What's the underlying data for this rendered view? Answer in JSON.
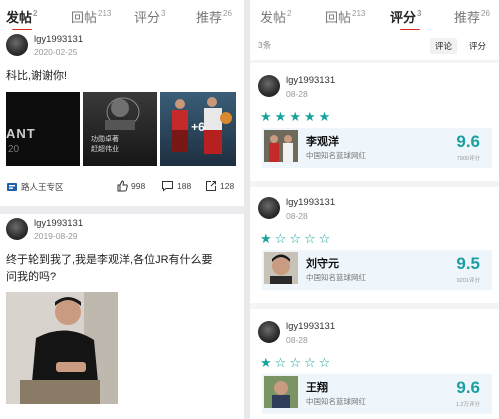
{
  "left": {
    "tabs": [
      {
        "label": "发帖",
        "count": "2",
        "active": true
      },
      {
        "label": "回帖",
        "count": "213",
        "active": false
      },
      {
        "label": "评分",
        "count": "3",
        "active": false
      },
      {
        "label": "推荐",
        "count": "26",
        "active": false
      }
    ],
    "posts": [
      {
        "username": "lgy1993131",
        "date": "2020-02-25",
        "text": "科比,谢谢你!",
        "image_overlay": "+6",
        "image_text_1": "ANT",
        "image_text_2": "20",
        "image_text_3": "功勋卓著",
        "image_text_4": "赶超伟业",
        "community": "路人王专区",
        "likes": "998",
        "comments": "188",
        "shares": "128"
      },
      {
        "username": "lgy1993131",
        "date": "2019-08-29",
        "text_line1": "终于轮到我了,我是李观洋,各位JR有什么要",
        "text_line2": "问我的吗?"
      }
    ]
  },
  "right": {
    "tabs": [
      {
        "label": "发帖",
        "count": "2",
        "active": false
      },
      {
        "label": "回帖",
        "count": "213",
        "active": false
      },
      {
        "label": "评分",
        "count": "3",
        "active": true
      },
      {
        "label": "推荐",
        "count": "26",
        "active": false
      }
    ],
    "count_label": "3条",
    "sort_options": [
      "评论",
      "评分"
    ],
    "ratings": [
      {
        "username": "lgy1993131",
        "date": "08-28",
        "stars": 5,
        "player": "李观洋",
        "desc": "中国知名篮球网红",
        "score": "9.6",
        "count": "7900评分"
      },
      {
        "username": "lgy1993131",
        "date": "08-28",
        "stars": 1,
        "player": "刘守元",
        "desc": "中国知名篮球网红",
        "score": "9.5",
        "count": "9201评分"
      },
      {
        "username": "lgy1993131",
        "date": "08-28",
        "stars": 1,
        "player": "王翔",
        "desc": "中国知名篮球网红",
        "score": "9.6",
        "count": "1.2万评分"
      }
    ]
  },
  "colors": {
    "accent": "#d22222",
    "score": "#1aa0a0",
    "star": "#16a39b",
    "player_bg": "#eef5fb"
  },
  "icons": [
    "like-icon",
    "comment-icon",
    "share-icon",
    "star-icon",
    "community-icon"
  ]
}
